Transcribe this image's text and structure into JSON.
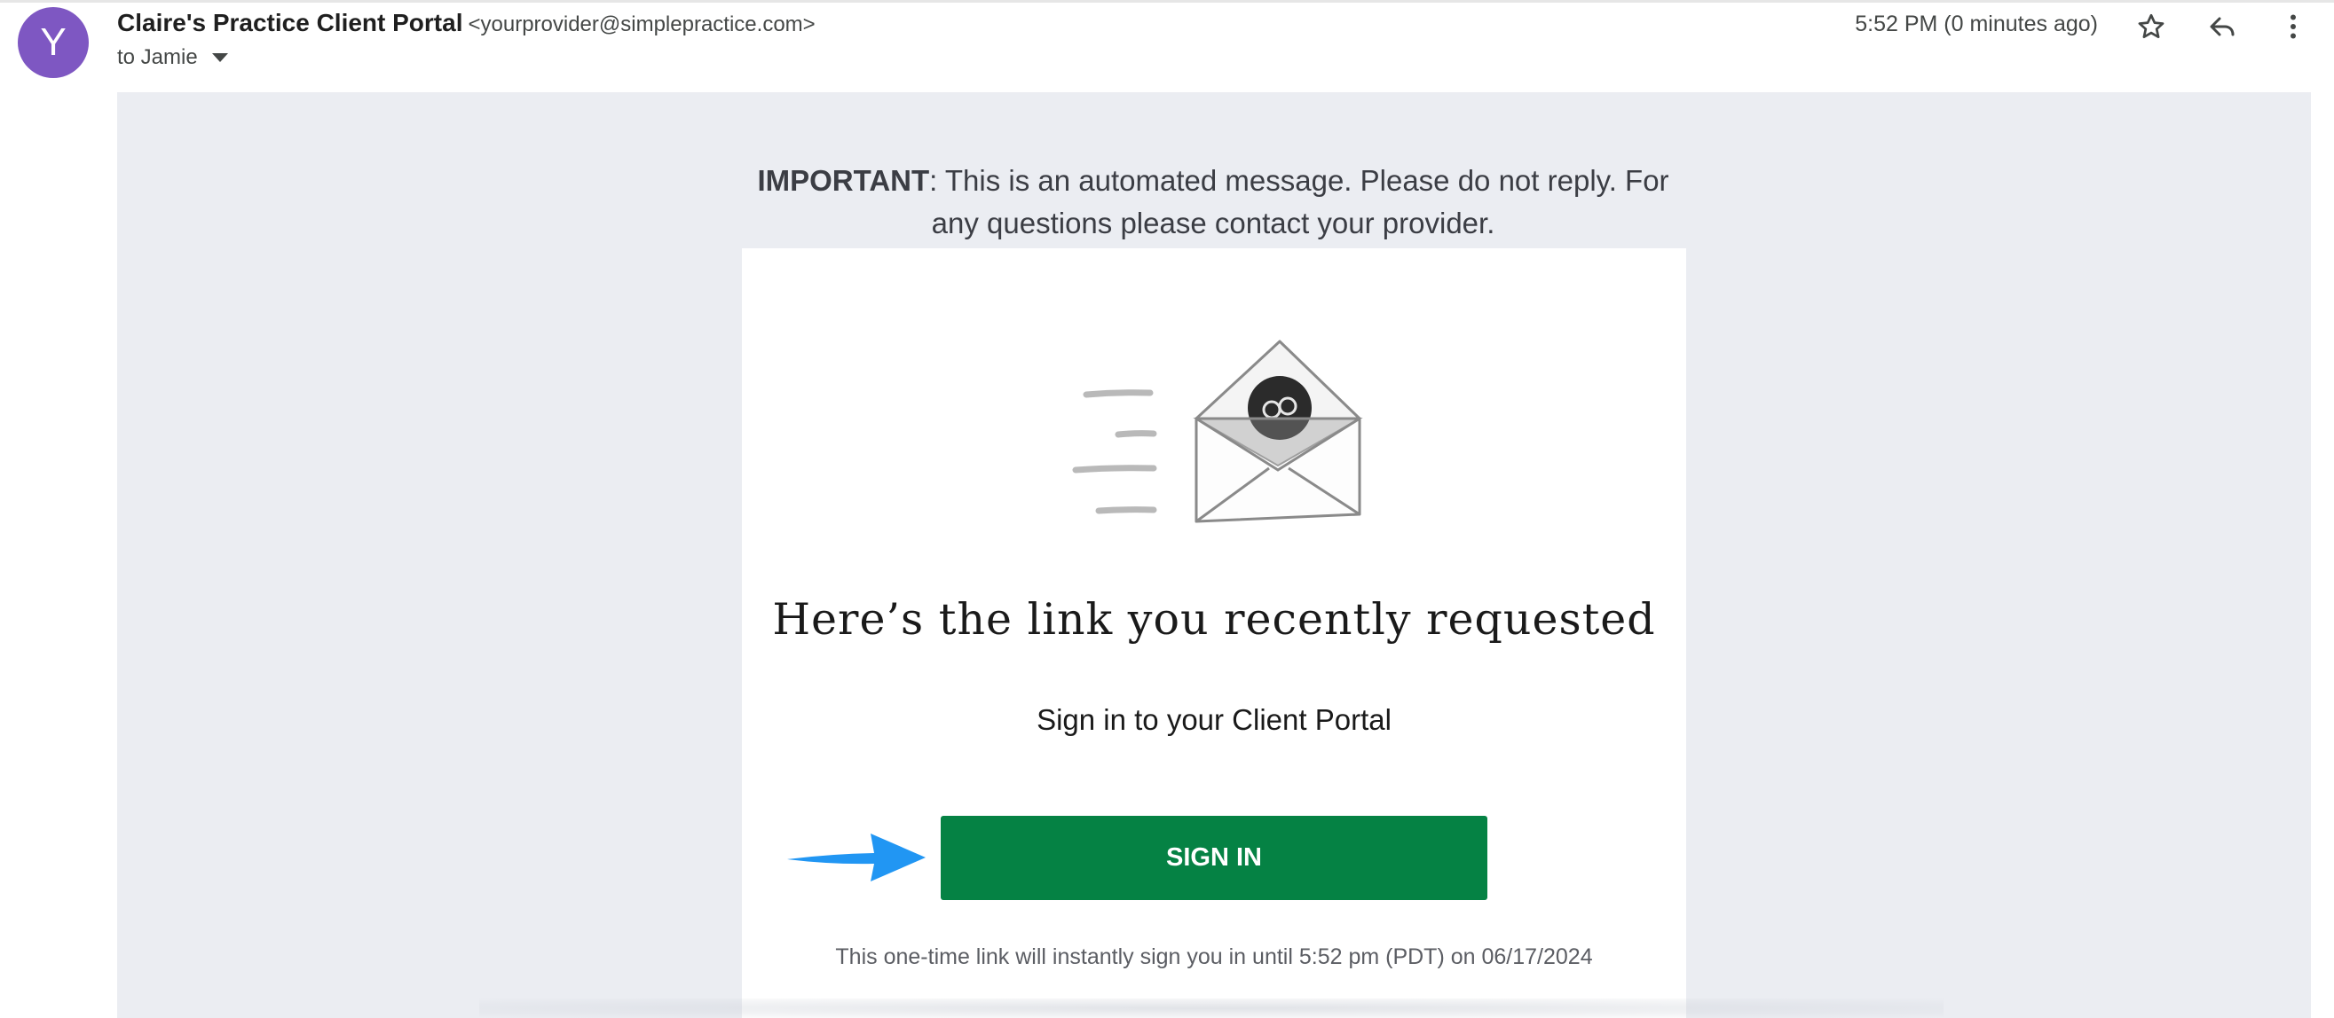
{
  "header": {
    "avatar_letter": "Y",
    "sender_name": "Claire's Practice Client Portal",
    "sender_email": "<yourprovider@simplepractice.com>",
    "recipient": "to Jamie",
    "timestamp": "5:52 PM (0 minutes ago)",
    "icons": [
      "star-icon",
      "reply-icon",
      "more-vert-icon"
    ]
  },
  "email": {
    "notice_bold": "IMPORTANT",
    "notice_text": ": This is an automated message. Please do not reply. For any questions please contact your provider.",
    "headline": "Here’s the link you recently requested",
    "subline": "Sign in to your Client Portal",
    "button_label": "SIGN IN",
    "footnote": "This one-time link will instantly sign you in until 5:52 pm (PDT) on 06/17/2024",
    "illustration_icon": "envelope-link-icon",
    "annotation_icon": "blue-arrow-icon"
  },
  "colors": {
    "avatar": "#7e57c2",
    "button": "#058244",
    "body_background": "#ebedf2",
    "annotation_arrow": "#2196f3"
  }
}
